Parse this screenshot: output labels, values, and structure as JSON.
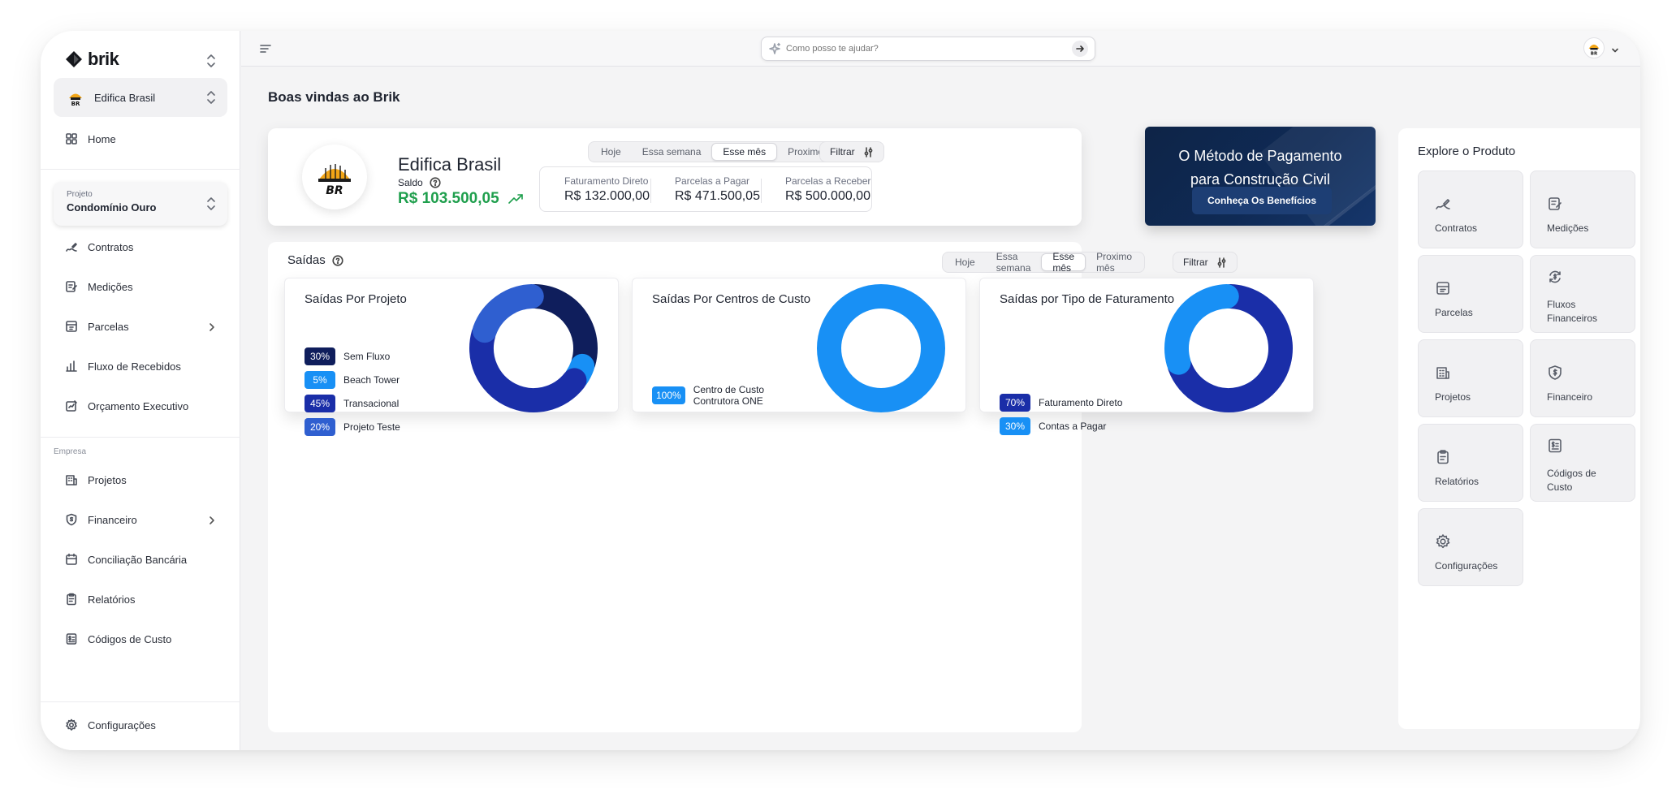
{
  "app": {
    "brand": "brik",
    "welcome": "Boas vindas ao Brik"
  },
  "sidebar": {
    "company": "Edifica Brasil",
    "home": "Home",
    "project": {
      "label": "Projeto",
      "value": "Condomínio Ouro"
    },
    "project_items": [
      "Contratos",
      "Medições",
      "Parcelas",
      "Fluxo de Recebidos",
      "Orçamento Executivo"
    ],
    "section_label": "Empresa",
    "company_items": [
      "Projetos",
      "Financeiro",
      "Conciliação Bancária",
      "Relatórios",
      "Códigos de Custo"
    ],
    "settings": "Configurações"
  },
  "topbar": {
    "search_placeholder": "Como posso te ajudar?"
  },
  "hero": {
    "name": "Edifica Brasil",
    "saldo_label": "Saldo",
    "saldo_value": "R$ 103.500,05",
    "period_options": [
      "Hoje",
      "Essa semana",
      "Esse mês",
      "Proximo mês"
    ],
    "active_period": "Esse mês",
    "filter_label": "Filtrar",
    "kpis": [
      {
        "label": "Faturamento Direto",
        "value": "R$ 132.000,00"
      },
      {
        "label": "Parcelas a Pagar",
        "value": "R$ 471.500,05"
      },
      {
        "label": "Parcelas a Receber",
        "value": "R$ 500.000,00"
      }
    ]
  },
  "promo": {
    "line1": "O Método de Pagamento",
    "line2": "para Construção Civil",
    "button": "Conheça Os Benefícios"
  },
  "saidas": {
    "title": "Saídas",
    "period_options": [
      "Hoje",
      "Essa semana",
      "Esse mês",
      "Proximo mês"
    ],
    "active_period": "Esse mês",
    "filter_label": "Filtrar",
    "charts": [
      {
        "title": "Saídas Por Projeto",
        "slices": [
          {
            "pct_label": "30%",
            "name": "Sem Fluxo",
            "value": 30,
            "color": "#0f1e5c"
          },
          {
            "pct_label": "5%",
            "name": "Beach Tower",
            "value": 5,
            "color": "#1890f5"
          },
          {
            "pct_label": "45%",
            "name": "Transacional",
            "value": 45,
            "color": "#1a2ea8"
          },
          {
            "pct_label": "20%",
            "name": "Projeto Teste",
            "value": 20,
            "color": "#2f5fd0"
          }
        ]
      },
      {
        "title": "Saídas Por Centros de Custo",
        "slices": [
          {
            "pct_label": "100%",
            "name": "Centro de Custo Contrutora ONE",
            "value": 100,
            "color": "#1890f5"
          }
        ]
      },
      {
        "title": "Saídas por Tipo de Faturamento",
        "slices": [
          {
            "pct_label": "70%",
            "name": "Faturamento Direto",
            "value": 70,
            "color": "#1a2ea8"
          },
          {
            "pct_label": "30%",
            "name": "Contas a Pagar",
            "value": 30,
            "color": "#1890f5"
          }
        ]
      }
    ]
  },
  "explore": {
    "title": "Explore o Produto",
    "tiles": [
      "Contratos",
      "Medições",
      "Parcelas",
      "Fluxos Financeiros",
      "Projetos",
      "Financeiro",
      "Relatórios",
      "Códigos de Custo",
      "Configurações"
    ]
  }
}
